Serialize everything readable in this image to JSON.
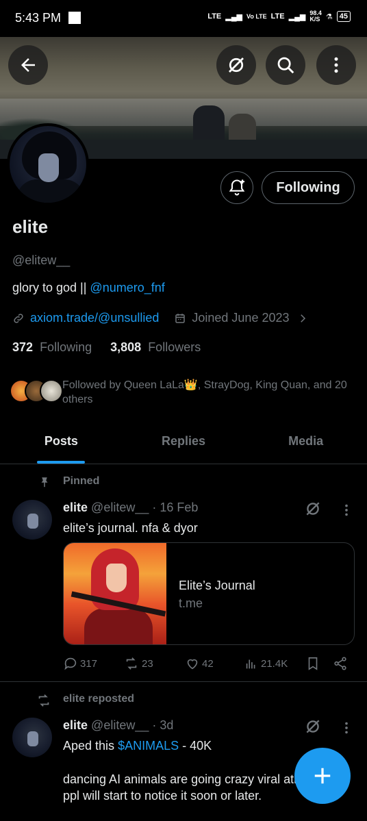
{
  "status_bar": {
    "time": "5:43 PM",
    "network_1": "LTE",
    "network_2": "Vo LTE",
    "network_3": "LTE",
    "speed": "98.4",
    "speed_unit": "K/S",
    "battery": "45"
  },
  "profile": {
    "name": "elite",
    "handle": "@elitew__",
    "bio_text": "glory to god || ",
    "bio_mention": "@numero_fnf",
    "website": "axiom.trade/@unsullied",
    "joined": "Joined June 2023",
    "following_count": "372",
    "following_label": "Following",
    "followers_count": "3,808",
    "followers_label": "Followers",
    "follow_button_label": "Following",
    "followed_by": "Followed by Queen LaLa👑, StrayDog, King Quan, and 20 others"
  },
  "tabs": [
    {
      "label": "Posts",
      "active": true
    },
    {
      "label": "Replies",
      "active": false
    },
    {
      "label": "Media",
      "active": false
    }
  ],
  "posts": [
    {
      "context": "Pinned",
      "name": "elite",
      "handle": "@elitew__",
      "time": "· 16 Feb",
      "text": "elite’s journal. nfa & dyor",
      "card": {
        "title": "Elite’s Journal",
        "domain": "t.me"
      },
      "replies": "317",
      "reposts": "23",
      "likes": "42",
      "views": "21.4K"
    },
    {
      "context": "elite reposted",
      "name": "elite",
      "handle": "@elitew__",
      "time": "· 3d",
      "text_prefix": "Aped this ",
      "text_cashtag": "$ANIMALS",
      "text_suffix": " - 40K",
      "text_body": "dancing AI animals are going crazy viral atm, i think ppl will start to notice it soon or later."
    }
  ],
  "colors": {
    "accent": "#1d9bf0",
    "background": "#000000",
    "secondary_text": "#71767b",
    "border": "#2f3336"
  },
  "icons": [
    "back-arrow-icon",
    "grok-icon",
    "search-icon",
    "more-vertical-icon",
    "bell-plus-icon",
    "link-icon",
    "calendar-icon",
    "chevron-right-icon",
    "pin-icon",
    "reply-icon",
    "repost-icon",
    "like-icon",
    "views-icon",
    "bookmark-icon",
    "share-icon",
    "plus-icon"
  ]
}
